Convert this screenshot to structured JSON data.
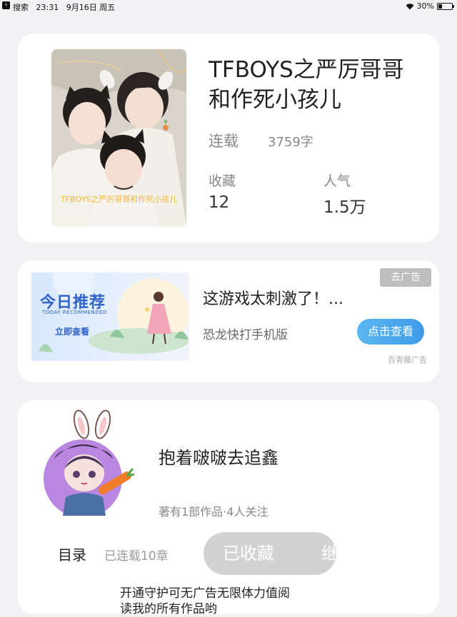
{
  "status_bar": {
    "back_label": "搜索",
    "time": "23:31",
    "date": "9月16日 周五",
    "battery": "30%",
    "battery_level": 0.3
  },
  "book": {
    "title": "TFBOYS之严厉哥哥和作死小孩儿",
    "cover_caption": "TFBOYS之严厉哥哥和作死小孩儿",
    "status": "连载",
    "word_count": "3759字",
    "favorites_label": "收藏",
    "favorites_value": "12",
    "popularity_label": "人气",
    "popularity_value": "1.5万"
  },
  "ad": {
    "image_title": "今日推荐",
    "image_subtitle": "TODAY RECOMMENDED",
    "image_button": "立即查看",
    "remove_label": "去广告",
    "headline": "这游戏太刺激了！...",
    "description": "恐龙快打手机版",
    "cta_label": "点击查看",
    "source": "百青藤广告"
  },
  "author": {
    "name": "抱着啵啵去追鑫",
    "meta": "著有1部作品·4人关注",
    "toc_label": "目录",
    "serial_label": "已连载10章",
    "collected_label": "已收藏",
    "continue_label": "继",
    "guard_text": "开通守护可无广告无限体力值阅读我的所有作品哟"
  },
  "colors": {
    "background": "#f2f2f4",
    "card": "#ffffff",
    "cta_blue": "#3f9be8",
    "collected_gray": "#d2d2d2",
    "ad_blue": "#2f63c8"
  }
}
